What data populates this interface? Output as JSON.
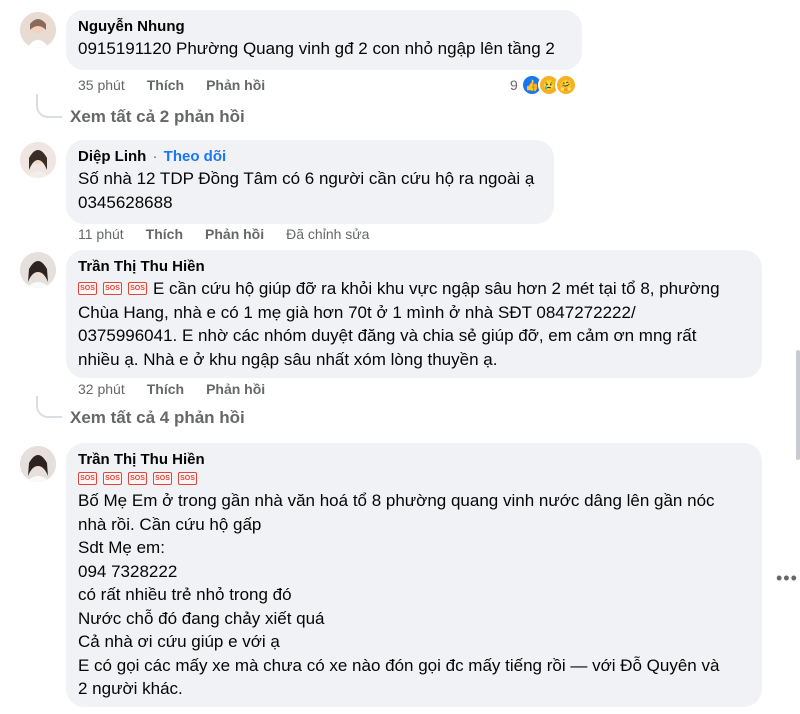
{
  "comments": [
    {
      "author": "Nguyễn Nhung",
      "text": "0915191120 Phường Quang vinh gđ 2 con nhỏ ngập lên tầng 2",
      "time": "35 phút",
      "like": "Thích",
      "reply": "Phản hồi",
      "reaction_count": "9",
      "view_replies": "Xem tất cả 2 phản hồi"
    },
    {
      "author": "Diệp Linh",
      "follow": "Theo dõi",
      "text": "Số nhà 12 TDP Đồng Tâm có 6 người cần cứu hộ ra ngoài ạ\n0345628688",
      "time": "11 phút",
      "like": "Thích",
      "reply": "Phản hồi",
      "edited": "Đã chỉnh sửa"
    },
    {
      "author": "Trần Thị Thu Hiền",
      "sos_label": "SOS",
      "text_after_sos": "E cần cứu hộ giúp đỡ ra khỏi khu vực ngập sâu hơn 2 mét tại tổ 8, phường",
      "text": "Chùa Hang, nhà e có 1 mẹ già hơn 70t ở 1 mình ở nhà SĐT 0847272222/\n0375996041. E nhờ các nhóm duyệt đăng và chia sẻ giúp đỡ, em cảm ơn mng rất\nnhiều ạ. Nhà e ở khu ngập sâu nhất xóm lòng thuyền ạ.",
      "time": "32 phút",
      "like": "Thích",
      "reply": "Phản hồi",
      "view_replies": "Xem tất cả 4 phản hồi"
    },
    {
      "author": "Trần Thị Thu Hiền",
      "sos_label": "SOS",
      "text": "Bố Mẹ Em ở trong gần nhà văn hoá tổ 8 phường quang vinh nước dâng lên gần nóc\nnhà rồi. Cần cứu hộ gấp\nSdt Mẹ em:\n094 7328222\ncó rất nhiều trẻ nhỏ trong đó\nNước chỗ đó đang chảy xiết quá\nCả nhà ơi cứu giúp e với ạ\nE có gọi các mấy xe mà chưa có xe nào đón gọi đc mấy tiếng rồi — với Đỗ Quyên và\n2 người khác."
    }
  ],
  "more_icon": "more-horizontal-icon",
  "colors": {
    "bubble": "#f0f2f5",
    "link": "#1877f2",
    "meta": "#65676b"
  }
}
